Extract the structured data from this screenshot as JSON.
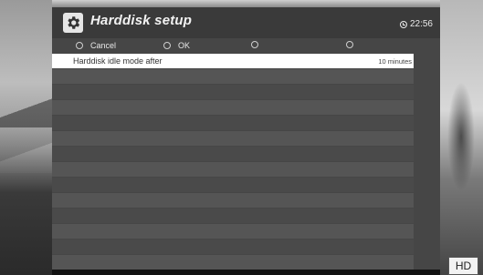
{
  "header": {
    "title": "Harddisk setup",
    "clock": "22:56",
    "icon": "gear-icon"
  },
  "buttons": [
    {
      "label": "Cancel",
      "color": "red"
    },
    {
      "label": "OK",
      "color": "green"
    },
    {
      "label": "",
      "color": "yellow"
    },
    {
      "label": "",
      "color": "blue"
    }
  ],
  "settings": [
    {
      "label": "Harddisk idle mode after",
      "value": "10 minutes",
      "selected": true
    }
  ],
  "badge": "HD",
  "colors": {
    "panel": "#464646",
    "selected_row": "#ffffff",
    "stripe_light": "#555555",
    "stripe_dark": "#4a4a4a"
  }
}
